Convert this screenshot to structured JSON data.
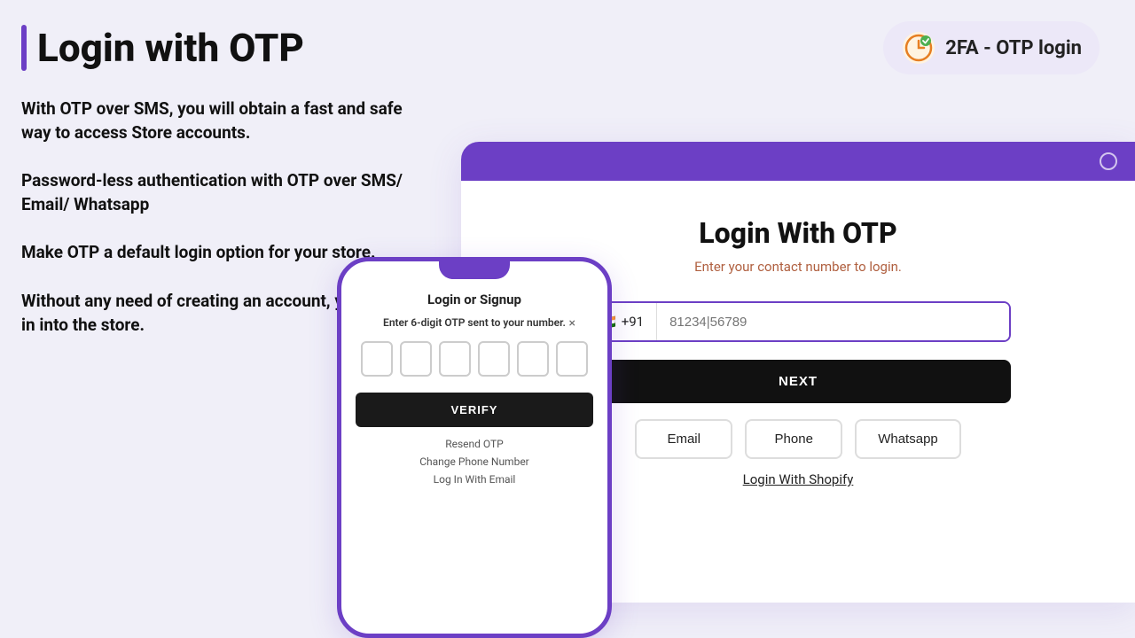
{
  "header": {
    "title": "Login with OTP",
    "badge": {
      "label": "2FA - OTP login"
    }
  },
  "left": {
    "features": [
      "With OTP over SMS, you will obtain a fast and safe way to access Store accounts.",
      "Password-less authentication with OTP over SMS/ Email/ Whatsapp",
      "Make OTP a default login option for your store.",
      "Without any need of creating an account, you can log in into the store."
    ]
  },
  "phone": {
    "dialog_title": "Login or Signup",
    "close_label": "×",
    "subtitle": "Enter 6-digit OTP sent to your number.",
    "verify_label": "VERIFY",
    "links": [
      "Resend OTP",
      "Change Phone Number",
      "Log In With Email"
    ]
  },
  "browser": {
    "login_title": "Login With OTP",
    "subtitle": "Enter your contact number to login.",
    "flag": "🇮🇳",
    "prefix": "+91",
    "phone_placeholder": "81234|56789",
    "next_label": "NEXT",
    "channels": [
      "Email",
      "Phone",
      "Whatsapp"
    ],
    "shopify_link": "Login With Shopify"
  },
  "colors": {
    "purple": "#6c3fc5",
    "dark": "#111111"
  }
}
